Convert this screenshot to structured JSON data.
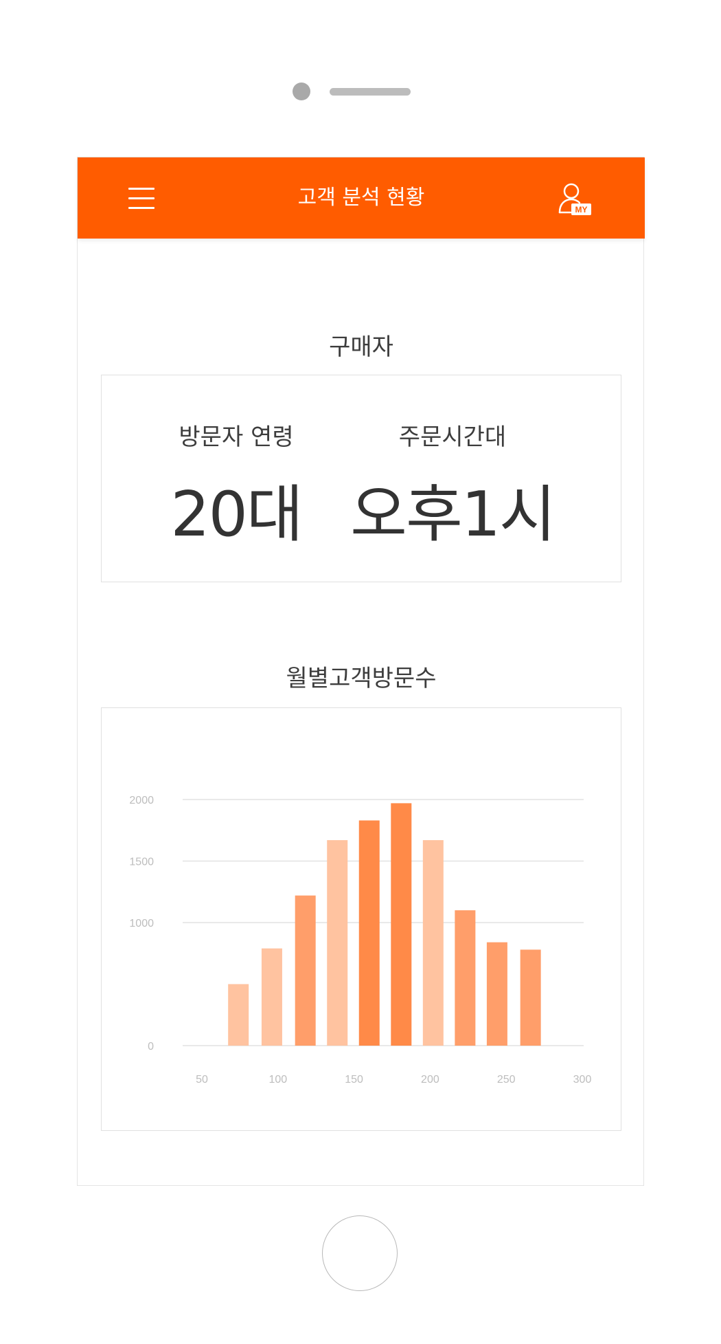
{
  "header": {
    "title": "고객 분석 현황",
    "my_badge": "MY",
    "color": "#ff5c00"
  },
  "buyer_section": {
    "title": "구매자",
    "stats": [
      {
        "label": "방문자 연령",
        "value": "20대"
      },
      {
        "label": "주문시간대",
        "value": "오후1시"
      }
    ]
  },
  "visits_section": {
    "title": "월별고객방문수"
  },
  "chart_data": {
    "type": "bar",
    "title": "월별고객방문수",
    "xlabel": "",
    "ylabel": "",
    "x_ticks": [
      50,
      100,
      150,
      200,
      250,
      300
    ],
    "y_ticks": [
      0,
      1000,
      1500,
      2000
    ],
    "xlim": [
      50,
      300
    ],
    "ylim": [
      0,
      2000
    ],
    "grid": true,
    "bars": [
      {
        "x": 74,
        "value": 500,
        "color": "#ffc3a0"
      },
      {
        "x": 96,
        "value": 790,
        "color": "#ffc3a0"
      },
      {
        "x": 118,
        "value": 1220,
        "color": "#ff9e6a"
      },
      {
        "x": 139,
        "value": 1670,
        "color": "#ffc3a0"
      },
      {
        "x": 160,
        "value": 1830,
        "color": "#ff8a48"
      },
      {
        "x": 181,
        "value": 1970,
        "color": "#ff8a48"
      },
      {
        "x": 202,
        "value": 1670,
        "color": "#ffc3a0"
      },
      {
        "x": 223,
        "value": 1100,
        "color": "#ff9e6a"
      },
      {
        "x": 244,
        "value": 840,
        "color": "#ff9e6a"
      },
      {
        "x": 266,
        "value": 780,
        "color": "#ff9e6a"
      }
    ],
    "colors": {
      "grid": "#e2e2e2",
      "tick_label": "#bdbdbd"
    }
  }
}
